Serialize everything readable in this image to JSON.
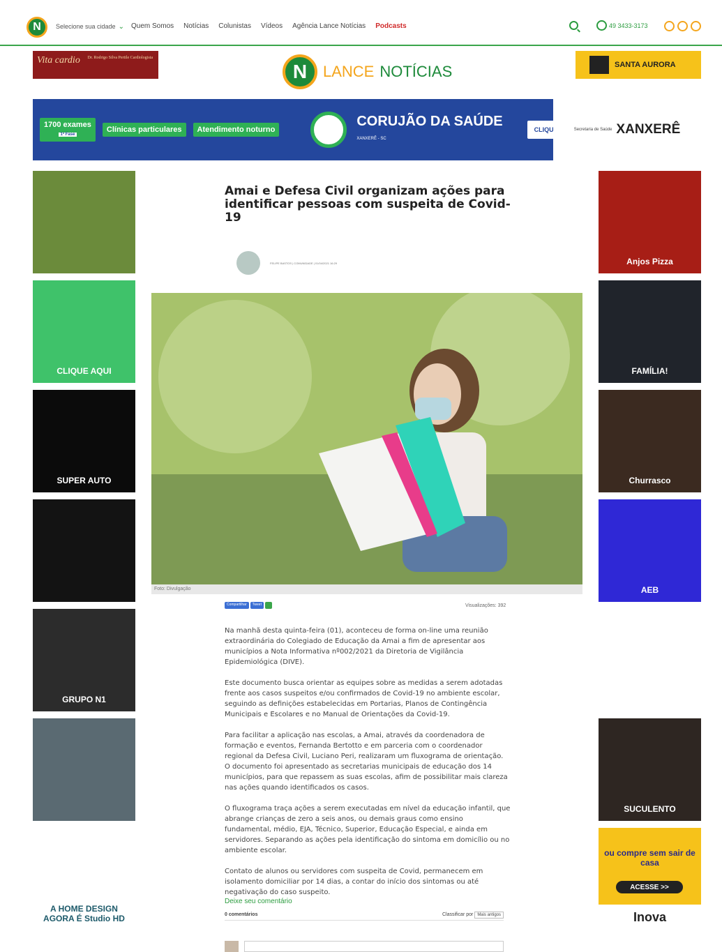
{
  "header": {
    "logo_letter": "N",
    "city_select": "Selecione sua cidade",
    "nav": [
      "Quem Somos",
      "Notícias",
      "Colunistas",
      "Vídeos",
      "Agência Lance Notícias",
      "Podcasts"
    ],
    "phone": "49 3433-3173"
  },
  "brand": {
    "letter": "N",
    "part1": "LANCE",
    "part2": "NOTÍCIAS"
  },
  "ads": {
    "cardio_text": "Vita cardio",
    "cardio_doctors": "Dr. Rodrigo Silva Pertile Cardiologista",
    "aurora_text": "SANTA AURORA",
    "banner": {
      "box1": "1700 exames",
      "box1_tag": "1ª Fase",
      "box2": "Clínicas particulares",
      "box3": "Atendimento noturno",
      "title": "CORUJÃO DA SAÚDE",
      "subtitle": "XANXERÊ - SC",
      "cta": "CLIQUE AQUI E SAIBA MAIS",
      "sponsor_small": "Secretaria de Saúde",
      "sponsor": "XANXERÊ"
    },
    "left": [
      {
        "text": "",
        "color": "#6b8b3b"
      },
      {
        "text": "CLIQUE AQUI",
        "color": "#3fc26a"
      },
      {
        "text": "SUPER AUTO",
        "color": "#0b0b0b"
      },
      {
        "text": "",
        "color": "#131313"
      },
      {
        "text": "GRUPO N1",
        "color": "#2c2c2c"
      },
      {
        "text": "",
        "color": "#5a6a72"
      },
      {
        "text": "A HOME DESIGN AGORA É Studio HD",
        "color": "#ffffff"
      }
    ],
    "right": [
      {
        "text": "Anjos Pizza",
        "color": "#a71e16"
      },
      {
        "text": "FAMÍLIA!",
        "color": "#20242b"
      },
      {
        "text": "Churrasco",
        "color": "#3b2a20"
      },
      {
        "text": "AEB",
        "color": "#2f28d6"
      },
      {
        "text": "",
        "color": "#ffffff"
      },
      {
        "text": "SUCULENTO",
        "color": "#2e2622"
      },
      {
        "text": "ou compre sem sair de casa",
        "color": "#f6c21a"
      }
    ],
    "right_cta": "ACESSE >>",
    "right_brand": "Inova"
  },
  "article": {
    "title": "Amai e Defesa Civil organizam ações para identificar pessoas com suspeita de Covid-19",
    "author_line": "FELIPE BASTOS | COMUNIDADE | 01/04/2021 16:29",
    "caption": "Foto: Divulgação",
    "share": [
      "Compartilhar",
      "Tweet"
    ],
    "views": "Visualizações: 392",
    "paragraphs": [
      "Na manhã desta quinta-feira (01), aconteceu de forma on-line uma reunião extraordinária do Colegiado de Educação da Amai a fim de apresentar aos municípios a Nota Informativa nº002/2021 da Diretoria de Vigilância Epidemiológica (DIVE).",
      "Este documento busca orientar as equipes sobre as medidas a serem adotadas frente aos casos suspeitos e/ou confirmados de Covid-19 no ambiente escolar, seguindo as definições estabelecidas em Portarias, Planos de Contingência Municipais e Escolares e no Manual de Orientações da Covid-19.",
      "Para facilitar a aplicação nas escolas, a Amai, através da coordenadora de formação e eventos, Fernanda Bertotto e em parceria com o coordenador regional da Defesa Civil, Luciano Peri, realizaram um fluxograma de orientação. O documento foi apresentado as secretarias municipais de educação dos 14 municípios, para que repassem as suas escolas, afim de possibilitar mais clareza nas ações quando identificados os casos.",
      "O fluxograma traça ações a serem executadas em nível da educação infantil, que abrange crianças de zero a seis anos, ou demais graus como ensino fundamental, médio, EJA, Técnico, Superior, Educação Especial, e ainda em servidores. Separando as ações pela identificação do sintoma em domicílio ou no ambiente escolar.",
      "Contato de alunos ou servidores com suspeita de Covid, permanecem em isolamento domiciliar por 14 dias, a contar do início dos sintomas ou até negativação do caso suspeito."
    ],
    "comment_link": "Deixe seu comentário",
    "comments_count": "0 comentários",
    "sort_label": "Classificar por",
    "sort_value": "Mais antigos"
  }
}
